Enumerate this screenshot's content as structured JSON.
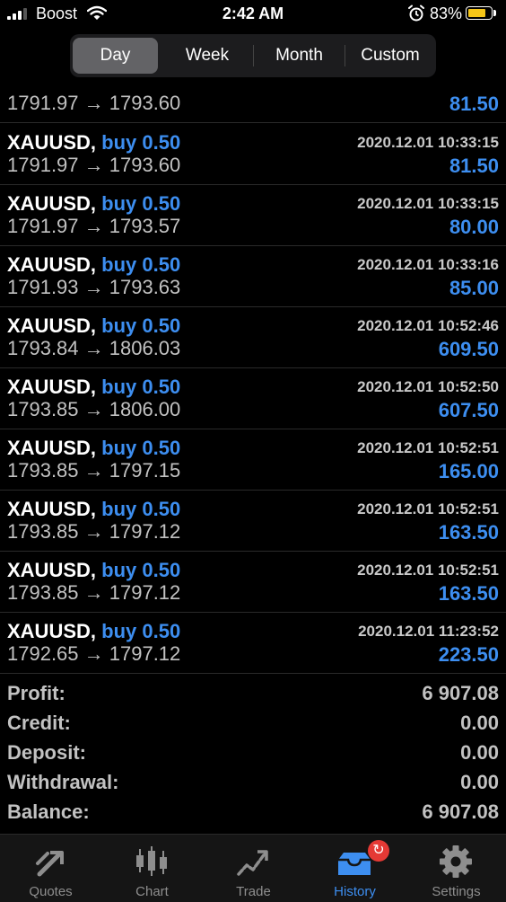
{
  "status_bar": {
    "carrier": "Boost",
    "time": "2:42 AM",
    "battery_percent": "83%",
    "battery_level": 0.83,
    "battery_color": "#f5c518"
  },
  "segments": [
    {
      "label": "Day",
      "active": true
    },
    {
      "label": "Week",
      "active": false
    },
    {
      "label": "Month",
      "active": false
    },
    {
      "label": "Custom",
      "active": false
    }
  ],
  "partial_row": {
    "prices": "1791.97 → 1793.60",
    "profit": "81.50"
  },
  "deals": [
    {
      "symbol": "XAUUSD,",
      "side": "buy 0.50",
      "time": "2020.12.01 10:33:15",
      "prices": "1791.97 → 1793.60",
      "profit": "81.50"
    },
    {
      "symbol": "XAUUSD,",
      "side": "buy 0.50",
      "time": "2020.12.01 10:33:15",
      "prices": "1791.97 → 1793.57",
      "profit": "80.00"
    },
    {
      "symbol": "XAUUSD,",
      "side": "buy 0.50",
      "time": "2020.12.01 10:33:16",
      "prices": "1791.93 → 1793.63",
      "profit": "85.00"
    },
    {
      "symbol": "XAUUSD,",
      "side": "buy 0.50",
      "time": "2020.12.01 10:52:46",
      "prices": "1793.84 → 1806.03",
      "profit": "609.50"
    },
    {
      "symbol": "XAUUSD,",
      "side": "buy 0.50",
      "time": "2020.12.01 10:52:50",
      "prices": "1793.85 → 1806.00",
      "profit": "607.50"
    },
    {
      "symbol": "XAUUSD,",
      "side": "buy 0.50",
      "time": "2020.12.01 10:52:51",
      "prices": "1793.85 → 1797.15",
      "profit": "165.00"
    },
    {
      "symbol": "XAUUSD,",
      "side": "buy 0.50",
      "time": "2020.12.01 10:52:51",
      "prices": "1793.85 → 1797.12",
      "profit": "163.50"
    },
    {
      "symbol": "XAUUSD,",
      "side": "buy 0.50",
      "time": "2020.12.01 10:52:51",
      "prices": "1793.85 → 1797.12",
      "profit": "163.50"
    },
    {
      "symbol": "XAUUSD,",
      "side": "buy 0.50",
      "time": "2020.12.01 11:23:52",
      "prices": "1792.65 → 1797.12",
      "profit": "223.50"
    }
  ],
  "summary": [
    {
      "label": "Profit:",
      "value": "6 907.08"
    },
    {
      "label": "Credit:",
      "value": "0.00"
    },
    {
      "label": "Deposit:",
      "value": "0.00"
    },
    {
      "label": "Withdrawal:",
      "value": "0.00"
    },
    {
      "label": "Balance:",
      "value": "6 907.08"
    }
  ],
  "tabs": [
    {
      "label": "Quotes",
      "icon": "quotes-icon",
      "active": false
    },
    {
      "label": "Chart",
      "icon": "chart-icon",
      "active": false
    },
    {
      "label": "Trade",
      "icon": "trade-icon",
      "active": false
    },
    {
      "label": "History",
      "icon": "history-icon",
      "active": true
    },
    {
      "label": "Settings",
      "icon": "settings-icon",
      "active": false
    }
  ],
  "colors": {
    "accent": "#3d8ef0",
    "badge": "#e53935"
  }
}
